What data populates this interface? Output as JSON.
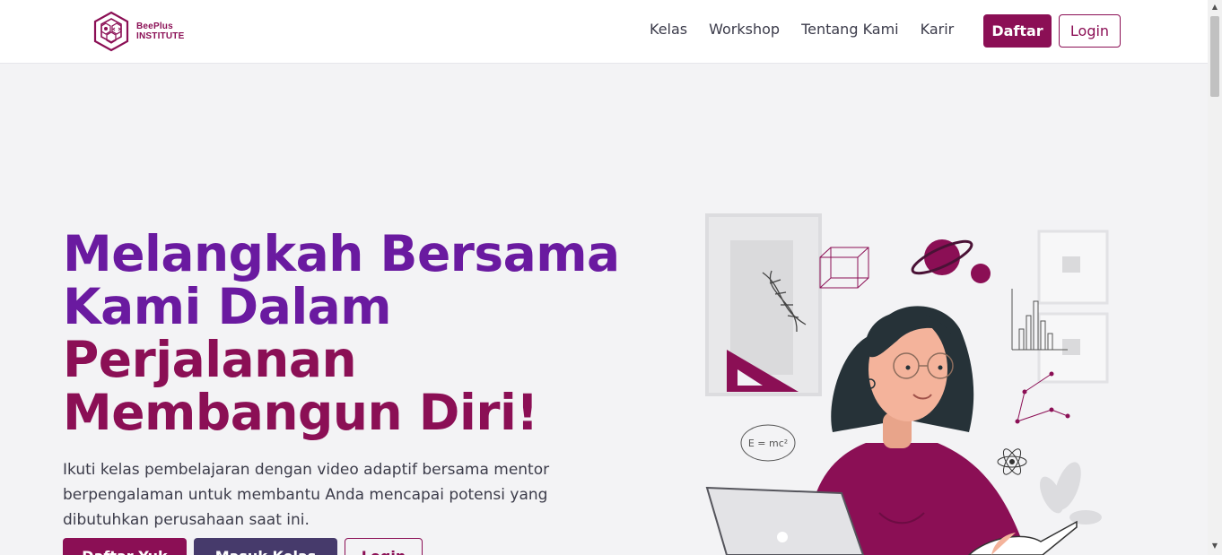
{
  "brand": {
    "name_line1": "BeePlus",
    "name_line2": "Institute",
    "color": "#8b0f55"
  },
  "nav": {
    "links": [
      "Kelas",
      "Workshop",
      "Tentang Kami",
      "Karir"
    ],
    "daftar_label": "Daftar",
    "login_label": "Login"
  },
  "hero": {
    "title_line1": "Melangkah Bersama",
    "title_line2": "Kami Dalam",
    "title_line3": "Perjalanan",
    "title_line4": "Membangun Diri!",
    "description": "Ikuti kelas pembelajaran dengan video adaptif bersama mentor berpengalaman untuk membantu Anda mencapai potensi yang dibutuhkan perusahaan saat ini.",
    "buttons": {
      "primary": "Daftar Yuk",
      "secondary": "Masuk Kelas",
      "outline": "Login"
    }
  },
  "illustration": {
    "formula": "E = mc²"
  },
  "colors": {
    "purple": "#6a1aa0",
    "magenta": "#8b0f55",
    "dark": "#463a6b"
  }
}
